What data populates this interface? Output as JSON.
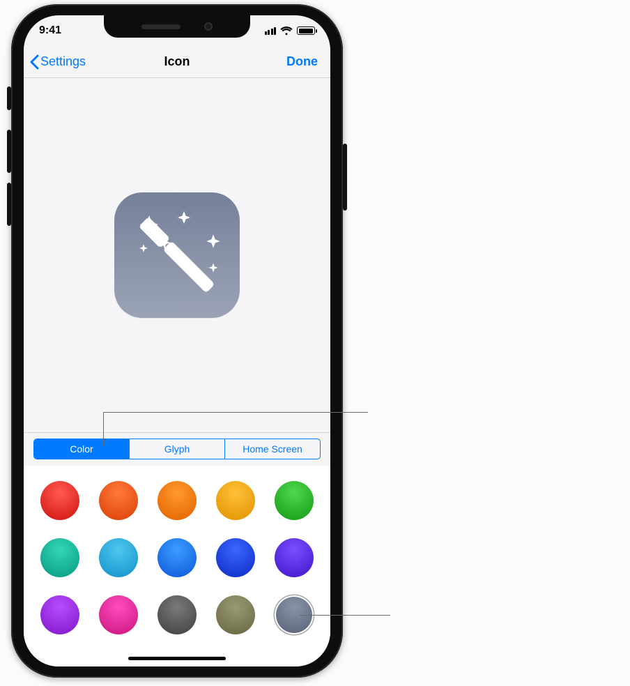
{
  "statusbar": {
    "time": "9:41",
    "signal_icon": "cellular-signal-icon",
    "wifi_icon": "wifi-icon",
    "battery_icon": "battery-icon"
  },
  "nav": {
    "back_label": "Settings",
    "title": "Icon",
    "done_label": "Done"
  },
  "preview": {
    "glyph_name": "magic-wand-icon",
    "tile_color": "bluegray"
  },
  "segmented": {
    "options": [
      {
        "label": "Color",
        "selected": true
      },
      {
        "label": "Glyph",
        "selected": false
      },
      {
        "label": "Home Screen",
        "selected": false
      }
    ]
  },
  "colors": [
    {
      "name": "red",
      "light": "#ff5a52",
      "dark": "#d9201a",
      "selected": false
    },
    {
      "name": "vermilion",
      "light": "#ff7a3c",
      "dark": "#e24a0e",
      "selected": false
    },
    {
      "name": "orange",
      "light": "#ff9a2e",
      "dark": "#e86b06",
      "selected": false
    },
    {
      "name": "amber",
      "light": "#ffc13a",
      "dark": "#e79a08",
      "selected": false
    },
    {
      "name": "green",
      "light": "#4fd84f",
      "dark": "#1fa51f",
      "selected": false
    },
    {
      "name": "teal",
      "light": "#33d6b6",
      "dark": "#0fa58a",
      "selected": false
    },
    {
      "name": "cyan",
      "light": "#4fc8ef",
      "dark": "#1c9bd0",
      "selected": false
    },
    {
      "name": "sky",
      "light": "#3d9bff",
      "dark": "#1565e0",
      "selected": false
    },
    {
      "name": "blue",
      "light": "#3a66ff",
      "dark": "#1536d0",
      "selected": false
    },
    {
      "name": "violet",
      "light": "#7a4dff",
      "dark": "#4d1fd4",
      "selected": false
    },
    {
      "name": "purple",
      "light": "#b84dff",
      "dark": "#8a1fd4",
      "selected": false
    },
    {
      "name": "magenta",
      "light": "#ff4dbf",
      "dark": "#d41f8a",
      "selected": false
    },
    {
      "name": "gray-dark",
      "light": "#7a7a7a",
      "dark": "#4a4a4a",
      "selected": false
    },
    {
      "name": "olive",
      "light": "#9a9a72",
      "dark": "#6f6f4a",
      "selected": false
    },
    {
      "name": "bluegray",
      "light": "#8a93a6",
      "dark": "#5f6a80",
      "selected": true
    }
  ]
}
